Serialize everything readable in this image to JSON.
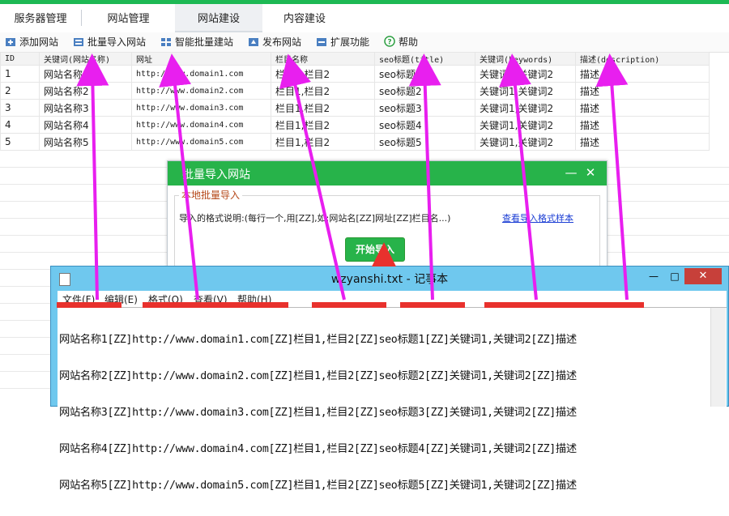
{
  "colors": {
    "accent_green": "#1db954",
    "dialog_green": "#27b34a",
    "annotation_magenta": "#e81fef",
    "annotation_red": "#e8312d",
    "notepad_title": "#6fc8ee"
  },
  "tabs": [
    {
      "label": "服务器管理",
      "active": false
    },
    {
      "label": "网站管理",
      "active": false
    },
    {
      "label": "网站建设",
      "active": true
    },
    {
      "label": "内容建设",
      "active": false
    }
  ],
  "toolbar": {
    "add_site": "添加网站",
    "batch_import": "批量导入网站",
    "smart_batch": "智能批量建站",
    "publish": "发布网站",
    "extensions": "扩展功能",
    "help": "帮助"
  },
  "icons": {
    "add": "plus-icon",
    "import": "import-icon",
    "smart": "grid-icon",
    "publish": "publish-icon",
    "extend": "extend-icon",
    "help": "help-circle-icon",
    "close": "close-icon",
    "minimize": "minimize-icon",
    "maximize": "maximize-icon",
    "notepad": "notepad-icon"
  },
  "table": {
    "headers": [
      "ID",
      "关键词(网站名称)",
      "网址",
      "栏目名称",
      "seo标题(title)",
      "关键词(keywords)",
      "描述(description)"
    ],
    "rows": [
      [
        "1",
        "网站名称1",
        "http://www.domain1.com",
        "栏目1,栏目2",
        "seo标题1",
        "关键词1,关键词2",
        "描述"
      ],
      [
        "2",
        "网站名称2",
        "http://www.domain2.com",
        "栏目1,栏目2",
        "seo标题2",
        "关键词1,关键词2",
        "描述"
      ],
      [
        "3",
        "网站名称3",
        "http://www.domain3.com",
        "栏目1,栏目2",
        "seo标题3",
        "关键词1,关键词2",
        "描述"
      ],
      [
        "4",
        "网站名称4",
        "http://www.domain4.com",
        "栏目1,栏目2",
        "seo标题4",
        "关键词1,关键词2",
        "描述"
      ],
      [
        "5",
        "网站名称5",
        "http://www.domain5.com",
        "栏目1,栏目2",
        "seo标题5",
        "关键词1,关键词2",
        "描述"
      ]
    ]
  },
  "dialog": {
    "title": "批量导入网站",
    "minimize": "—",
    "close": "✕",
    "group_label": "本地批量导入",
    "format_desc": "导入的格式说明:(每行一个,用[ZZ],如:网站名[ZZ]网址[ZZ]栏目名...)",
    "format_link": "查看导入格式样本",
    "start_button": "开始导入"
  },
  "notepad": {
    "title": "wzyanshi.txt - 记事本",
    "minimize": "—",
    "maximize": "□",
    "close": "✕",
    "menu": [
      "文件(F)",
      "编辑(E)",
      "格式(O)",
      "查看(V)",
      "帮助(H)"
    ],
    "lines": [
      "网站名称1[ZZ]http://www.domain1.com[ZZ]栏目1,栏目2[ZZ]seo标题1[ZZ]关键词1,关键词2[ZZ]描述",
      "网站名称2[ZZ]http://www.domain2.com[ZZ]栏目1,栏目2[ZZ]seo标题2[ZZ]关键词1,关键词2[ZZ]描述",
      "网站名称3[ZZ]http://www.domain3.com[ZZ]栏目1,栏目2[ZZ]seo标题3[ZZ]关键词1,关键词2[ZZ]描述",
      "网站名称4[ZZ]http://www.domain4.com[ZZ]栏目1,栏目2[ZZ]seo标题4[ZZ]关键词1,关键词2[ZZ]描述",
      "网站名称5[ZZ]http://www.domain5.com[ZZ]栏目1,栏目2[ZZ]seo标题5[ZZ]关键词1,关键词2[ZZ]描述"
    ]
  }
}
